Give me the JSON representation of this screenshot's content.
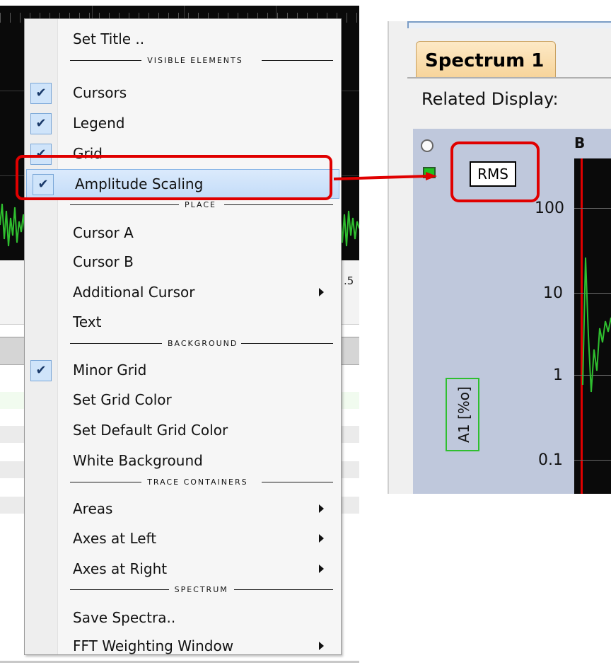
{
  "menu": {
    "items": [
      {
        "type": "item",
        "label": "Set Title ..",
        "checked": false,
        "submenu": false
      },
      {
        "type": "separator",
        "label": "VISIBLE ELEMENTS"
      },
      {
        "type": "item",
        "label": "Cursors",
        "checked": true,
        "submenu": false
      },
      {
        "type": "item",
        "label": "Legend",
        "checked": true,
        "submenu": false
      },
      {
        "type": "item",
        "label": "Grid",
        "checked": true,
        "submenu": false
      },
      {
        "type": "item",
        "label": "Amplitude Scaling",
        "checked": true,
        "submenu": false,
        "highlighted": true
      },
      {
        "type": "separator",
        "label": "PLACE"
      },
      {
        "type": "item",
        "label": "Cursor A",
        "checked": false,
        "submenu": false
      },
      {
        "type": "item",
        "label": "Cursor B",
        "checked": false,
        "submenu": false
      },
      {
        "type": "item",
        "label": "Additional Cursor",
        "checked": false,
        "submenu": true
      },
      {
        "type": "item",
        "label": "Text",
        "checked": false,
        "submenu": false
      },
      {
        "type": "separator",
        "label": "BACKGROUND"
      },
      {
        "type": "item",
        "label": "Minor Grid",
        "checked": true,
        "submenu": false
      },
      {
        "type": "item",
        "label": "Set Grid Color",
        "checked": false,
        "submenu": false
      },
      {
        "type": "item",
        "label": "Set Default Grid Color",
        "checked": false,
        "submenu": false
      },
      {
        "type": "item",
        "label": "White Background",
        "checked": false,
        "submenu": false
      },
      {
        "type": "separator",
        "label": "TRACE CONTAINERS"
      },
      {
        "type": "item",
        "label": "Areas",
        "checked": false,
        "submenu": true
      },
      {
        "type": "item",
        "label": "Axes at Left",
        "checked": false,
        "submenu": true
      },
      {
        "type": "item",
        "label": "Axes at Right",
        "checked": false,
        "submenu": true
      },
      {
        "type": "separator",
        "label": "SPECTRUM"
      },
      {
        "type": "item",
        "label": "Save Spectra..",
        "checked": false,
        "submenu": false
      },
      {
        "type": "item",
        "label": "FFT Weighting Window",
        "checked": false,
        "submenu": true
      }
    ]
  },
  "left_app": {
    "axis_tick_label": ".5"
  },
  "right_panel": {
    "tab_label": "Spectrum 1",
    "related_display_label": "Related Display:",
    "scaling_badge": "RMS",
    "b_label": "B",
    "y_ticks": [
      "100",
      "10",
      "1",
      "0.1"
    ],
    "axis_label": "A1 [%o]"
  },
  "colors": {
    "highlight_red": "#e00000",
    "trace_green": "#2fbf2f",
    "menu_highlight": "#cfe4fa",
    "tab_orange": "#f7d49a"
  }
}
